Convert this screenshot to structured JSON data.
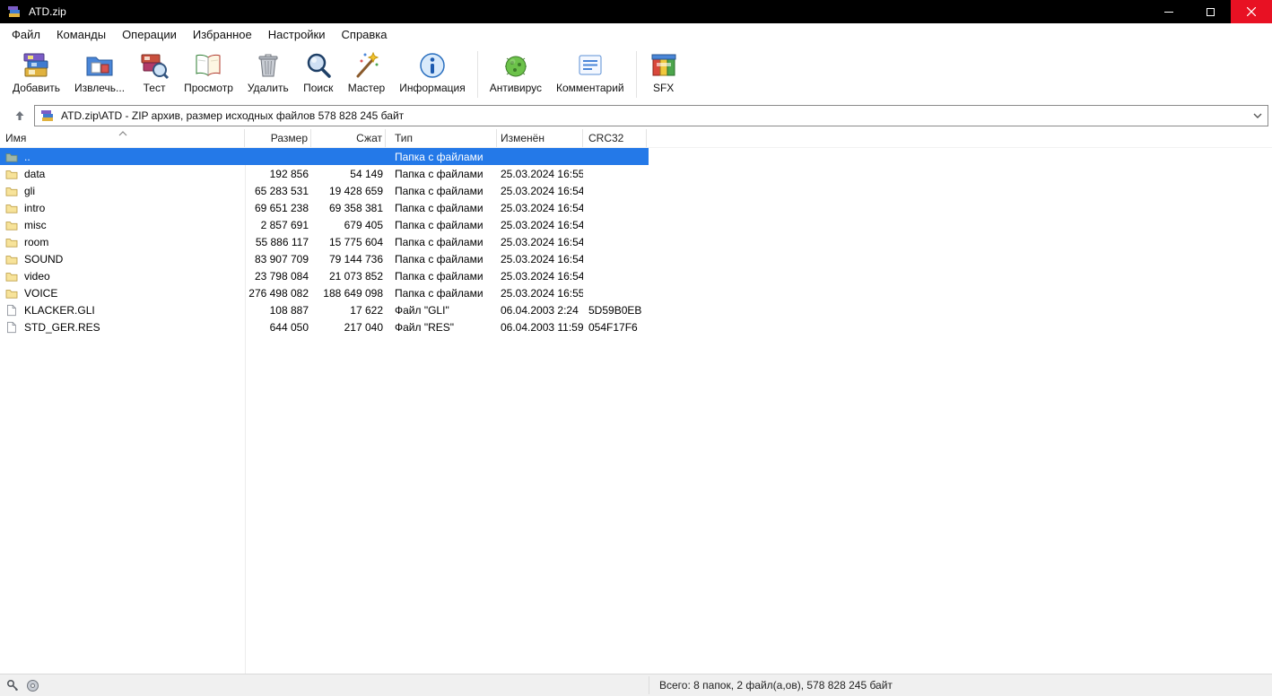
{
  "window": {
    "title": "ATD.zip"
  },
  "menu": [
    "Файл",
    "Команды",
    "Операции",
    "Избранное",
    "Настройки",
    "Справка"
  ],
  "toolbar": {
    "items": [
      {
        "label": "Добавить",
        "icon": "add-archive-icon"
      },
      {
        "label": "Извлечь...",
        "icon": "extract-icon"
      },
      {
        "label": "Тест",
        "icon": "test-icon"
      },
      {
        "label": "Просмотр",
        "icon": "view-icon"
      },
      {
        "label": "Удалить",
        "icon": "delete-icon"
      },
      {
        "label": "Поиск",
        "icon": "search-icon"
      },
      {
        "label": "Мастер",
        "icon": "wizard-icon"
      },
      {
        "label": "Информация",
        "icon": "info-icon"
      },
      {
        "label": "Антивирус",
        "icon": "antivirus-icon"
      },
      {
        "label": "Комментарий",
        "icon": "comment-icon"
      },
      {
        "label": "SFX",
        "icon": "sfx-icon"
      }
    ]
  },
  "addressbar": {
    "path": "ATD.zip\\ATD - ZIP архив, размер исходных файлов 578 828 245 байт"
  },
  "table": {
    "columns": [
      "Имя",
      "Размер",
      "Сжат",
      "Тип",
      "Изменён",
      "CRC32"
    ],
    "rows": [
      {
        "kind": "up",
        "selected": true,
        "name": "..",
        "size": "",
        "packed": "",
        "type": "Папка с файлами",
        "modified": "",
        "crc": ""
      },
      {
        "kind": "folder",
        "selected": false,
        "name": "data",
        "size": "192 856",
        "packed": "54 149",
        "type": "Папка с файлами",
        "modified": "25.03.2024 16:55",
        "crc": ""
      },
      {
        "kind": "folder",
        "selected": false,
        "name": "gli",
        "size": "65 283 531",
        "packed": "19 428 659",
        "type": "Папка с файлами",
        "modified": "25.03.2024 16:54",
        "crc": ""
      },
      {
        "kind": "folder",
        "selected": false,
        "name": "intro",
        "size": "69 651 238",
        "packed": "69 358 381",
        "type": "Папка с файлами",
        "modified": "25.03.2024 16:54",
        "crc": ""
      },
      {
        "kind": "folder",
        "selected": false,
        "name": "misc",
        "size": "2 857 691",
        "packed": "679 405",
        "type": "Папка с файлами",
        "modified": "25.03.2024 16:54",
        "crc": ""
      },
      {
        "kind": "folder",
        "selected": false,
        "name": "room",
        "size": "55 886 117",
        "packed": "15 775 604",
        "type": "Папка с файлами",
        "modified": "25.03.2024 16:54",
        "crc": ""
      },
      {
        "kind": "folder",
        "selected": false,
        "name": "SOUND",
        "size": "83 907 709",
        "packed": "79 144 736",
        "type": "Папка с файлами",
        "modified": "25.03.2024 16:54",
        "crc": ""
      },
      {
        "kind": "folder",
        "selected": false,
        "name": "video",
        "size": "23 798 084",
        "packed": "21 073 852",
        "type": "Папка с файлами",
        "modified": "25.03.2024 16:54",
        "crc": ""
      },
      {
        "kind": "folder",
        "selected": false,
        "name": "VOICE",
        "size": "276 498 082",
        "packed": "188 649 098",
        "type": "Папка с файлами",
        "modified": "25.03.2024 16:55",
        "crc": ""
      },
      {
        "kind": "file",
        "selected": false,
        "name": "KLACKER.GLI",
        "size": "108 887",
        "packed": "17 622",
        "type": "Файл \"GLI\"",
        "modified": "06.04.2003 2:24",
        "crc": "5D59B0EB"
      },
      {
        "kind": "file",
        "selected": false,
        "name": "STD_GER.RES",
        "size": "644 050",
        "packed": "217 040",
        "type": "Файл \"RES\"",
        "modified": "06.04.2003 11:59",
        "crc": "054F17F6"
      }
    ]
  },
  "statusbar": {
    "total": "Всего: 8 папок, 2 файл(а,ов), 578 828 245 байт"
  },
  "colors": {
    "titlebar": "#000000",
    "close_button": "#e81123",
    "selection": "#2479e8",
    "statusbar_bg": "#f0f0f0"
  }
}
